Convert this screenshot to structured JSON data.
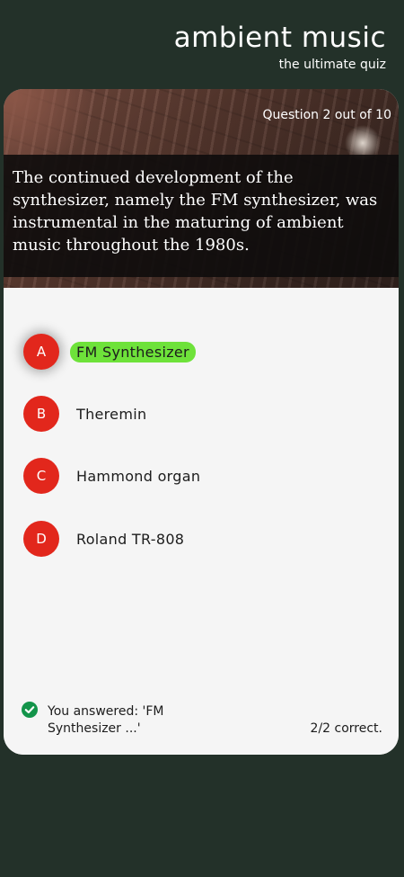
{
  "header": {
    "title": "ambient music",
    "subtitle": "the ultimate quiz"
  },
  "quiz": {
    "progress": "Question 2 out of 10",
    "question": "The continued development of the synthesizer, namely the FM synthesizer, was instrumental in the maturing of ambient music throughout the 1980s.",
    "options": [
      {
        "letter": "A",
        "label": "FM Synthesizer",
        "selected": true
      },
      {
        "letter": "B",
        "label": "Theremin",
        "selected": false
      },
      {
        "letter": "C",
        "label": "Hammond organ",
        "selected": false
      },
      {
        "letter": "D",
        "label": "Roland TR-808",
        "selected": false
      }
    ]
  },
  "footer": {
    "answered": "You answered: 'FM Synthesizer ...'",
    "score": "2/2 correct."
  },
  "colors": {
    "background": "#233129",
    "badge": "#e2271c",
    "highlight": "#6ee23a",
    "check": "#13944a"
  },
  "icons": {
    "footer": "check-circle-icon"
  }
}
